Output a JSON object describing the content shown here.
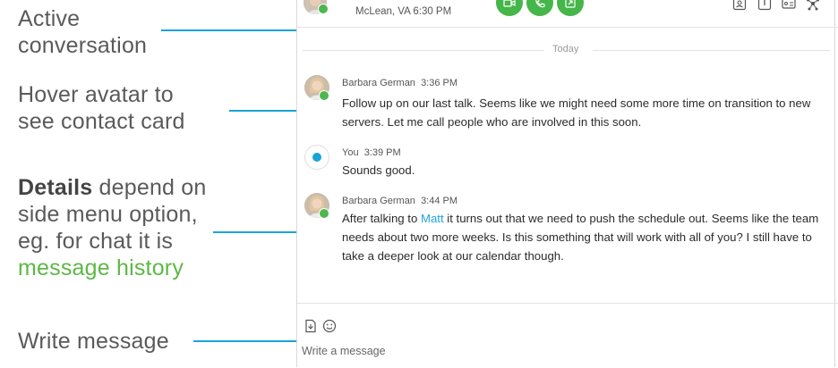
{
  "annotations": {
    "active_conversation": [
      "Active",
      "conversation"
    ],
    "hover_avatar": [
      "Hover avatar to",
      "see contact card"
    ],
    "details": {
      "bold": "Details",
      "rest_line1": " depend on",
      "line2": "side menu option,",
      "line3": "eg. for chat it is",
      "green": "message history"
    },
    "write_message": "Write message"
  },
  "header": {
    "location": "McLean, VA 6:30 PM",
    "buttons": [
      "video-call",
      "audio-call",
      "share-screen"
    ]
  },
  "divider": {
    "label": "Today"
  },
  "messages": [
    {
      "author": "Barbara German",
      "time": "3:36 PM",
      "text": "Follow up on our last talk. Seems like we might need some more time on transition to new servers. Let me call people who are involved in this soon."
    },
    {
      "author": "You",
      "time": "3:39 PM",
      "text": "Sounds good."
    },
    {
      "author": "Barbara German",
      "time": "3:44 PM",
      "text_before": "After talking to ",
      "mention": "Matt",
      "text_after": " it turns out that we need to push the schedule out. Seems like the team needs about two more weeks. Is this something that will work with all of you? I still have to take a deeper look at our calendar though."
    }
  ],
  "composer": {
    "placeholder": "Write a message"
  },
  "colors": {
    "accent": "#1aa3d9",
    "call_green": "#45b649",
    "highlight_green": "#5db845",
    "presence": "#4cb74e"
  }
}
